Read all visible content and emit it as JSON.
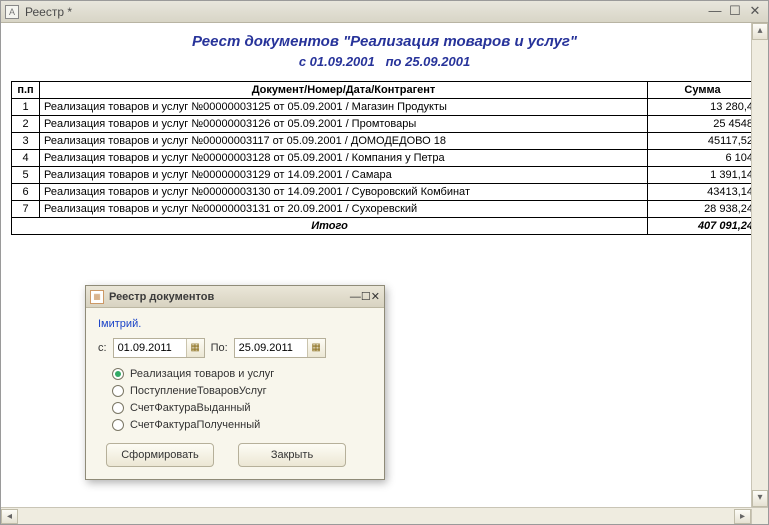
{
  "window": {
    "title": "Реестр *",
    "icon_label": "A"
  },
  "report": {
    "title": "Реест документов \"Реализация товаров и услуг\"",
    "date_from": "01.09.2001",
    "date_to": "25.09.2001",
    "subtitle_prefix": "с",
    "subtitle_separator": "по",
    "columns": {
      "num": "п.п",
      "doc": "Документ/Номер/Дата/Контрагент",
      "sum": "Сумма"
    },
    "rows": [
      {
        "n": "1",
        "doc": "Реализация товаров и услуг №00000003125 от 05.09.2001 / Магазин Продукты",
        "sum": "13 280,4"
      },
      {
        "n": "2",
        "doc": "Реализация товаров и услуг №00000003126 от 05.09.2001 / Промтовары",
        "sum": "25 4548"
      },
      {
        "n": "3",
        "doc": "Реализация товаров и услуг №00000003117 от 05.09.2001 / ДОМОДЕДОВО 18",
        "sum": "45117,52"
      },
      {
        "n": "4",
        "doc": "Реализация товаров и услуг №00000003128 от 05.09.2001 / Компания у Петра",
        "sum": "6 104"
      },
      {
        "n": "5",
        "doc": "Реализация товаров и услуг №00000003129 от 14.09.2001 / Самара",
        "sum": "1 391,14"
      },
      {
        "n": "6",
        "doc": "Реализация товаров и услуг №00000003130 от 14.09.2001 / Суворовский Комбинат",
        "sum": "43413,14"
      },
      {
        "n": "7",
        "doc": "Реализация товаров и услуг №00000003131 от 20.09.2001 / Сухоревский",
        "sum": "28 938,24"
      }
    ],
    "total_label": "Итого",
    "total_sum": "407 091,24"
  },
  "dialog": {
    "title": "Реестр документов",
    "user": "Iмитрий.",
    "from_label": "с:",
    "to_label": "По:",
    "date_from": "01.09.2011",
    "date_to": "25.09.2011",
    "radios": [
      {
        "label": "Реализация товаров и услуг",
        "selected": true
      },
      {
        "label": "ПоступлениеТоваровУслуг",
        "selected": false
      },
      {
        "label": "СчетФактураВыданный",
        "selected": false
      },
      {
        "label": "СчетФактураПолученный",
        "selected": false
      }
    ],
    "btn_generate": "Сформировать",
    "btn_close": "Закрыть"
  }
}
